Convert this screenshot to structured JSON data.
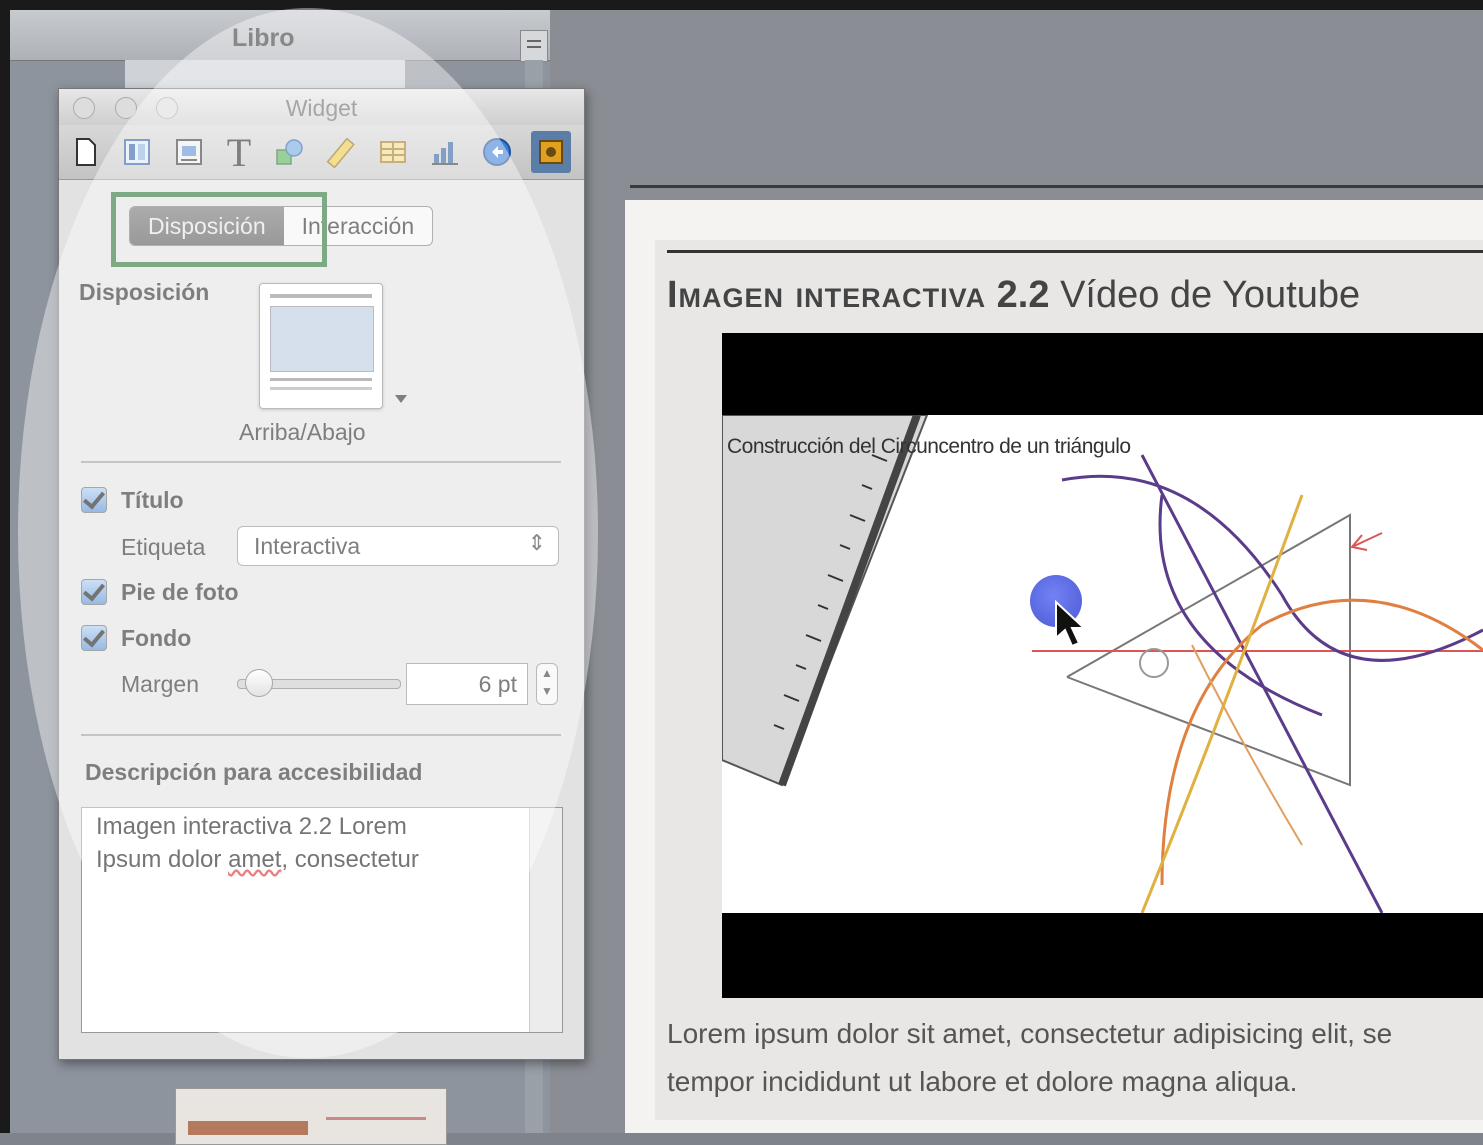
{
  "sidebar": {
    "title": "Libro"
  },
  "inspector": {
    "window_title": "Widget",
    "toolbar": [
      {
        "icon": "document-icon"
      },
      {
        "icon": "layout-icon"
      },
      {
        "icon": "wrap-icon"
      },
      {
        "icon": "text-icon",
        "glyph": "T"
      },
      {
        "icon": "shape-icon"
      },
      {
        "icon": "ruler-icon"
      },
      {
        "icon": "table-icon"
      },
      {
        "icon": "chart-icon"
      },
      {
        "icon": "link-icon"
      },
      {
        "icon": "widget-icon"
      }
    ],
    "tabs": {
      "layout": "Disposición",
      "interaction": "Interacción"
    },
    "layout_label": "Disposición",
    "layout_value": "Arriba/Abajo",
    "title_checkbox": "Título",
    "tag_label": "Etiqueta",
    "tag_value": "Interactiva",
    "caption_checkbox": "Pie de foto",
    "background_checkbox": "Fondo",
    "margin_label": "Margen",
    "margin_value": "6 pt",
    "accessibility_label": "Descripción para accesibilidad",
    "accessibility_text_1": "Imagen interactiva 2.2 Lorem",
    "accessibility_text_2a": "Ipsum dolor ",
    "accessibility_text_2b": "amet",
    "accessibility_text_2c": ", consectetur"
  },
  "page": {
    "title_label": "Imagen interactiva",
    "title_number": "2.2",
    "title_text": "Vídeo de Youtube",
    "video_caption": "Construcción del Circuncentro de un triángulo",
    "body_line_1": "Lorem ipsum dolor sit amet, consectetur adipisicing elit, se",
    "body_line_2": "tempor incididunt ut labore et dolore magna aliqua."
  },
  "colors": {
    "highlight_box": "#1f6b2e",
    "checkbox": "#4d88cf",
    "cursor_dot": "#3a4be0"
  }
}
